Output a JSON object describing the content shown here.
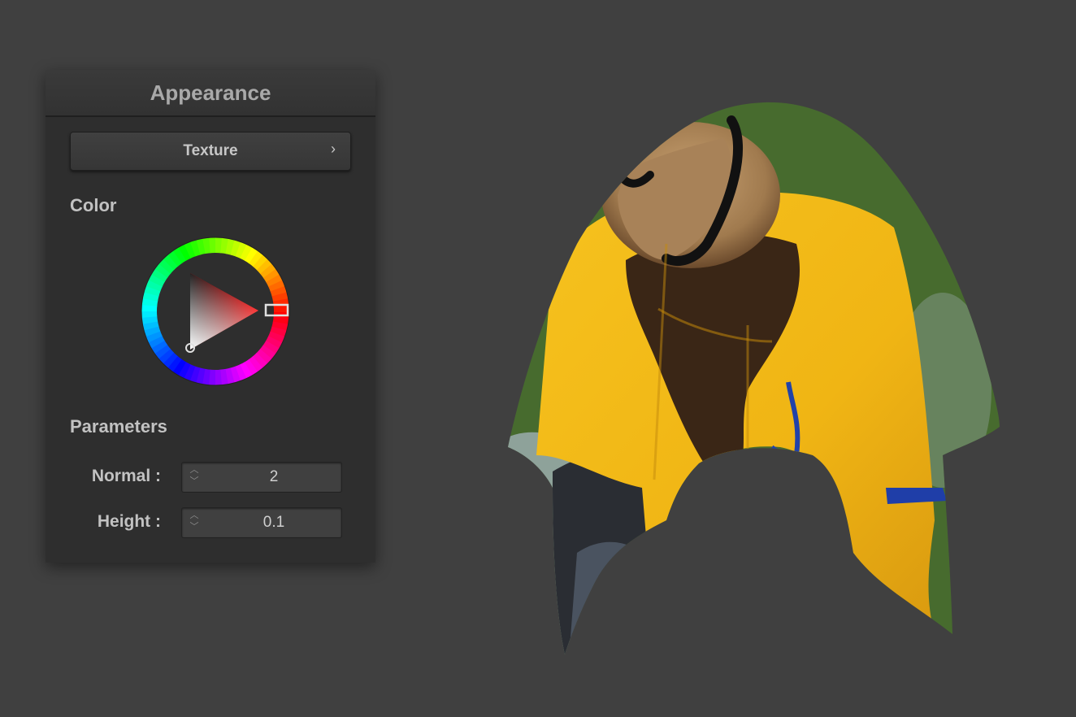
{
  "panel": {
    "title": "Appearance",
    "texture_button": {
      "label": "Texture",
      "chevron_icon": "chevron-right-icon"
    },
    "color_section": {
      "label": "Color",
      "selected_hue": "#ff0000"
    },
    "parameters_section": {
      "label": "Parameters",
      "params": [
        {
          "label": "Normal :",
          "value": "2"
        },
        {
          "label": "Height :",
          "value": "0.1"
        }
      ]
    }
  },
  "colors": {
    "viewport_bg": "#404040",
    "panel_bg": "#2e2e2e",
    "cloth_yellow": "#f2b81a",
    "cloth_green": "#476b2e",
    "cloth_fur": "#b08a5c"
  }
}
